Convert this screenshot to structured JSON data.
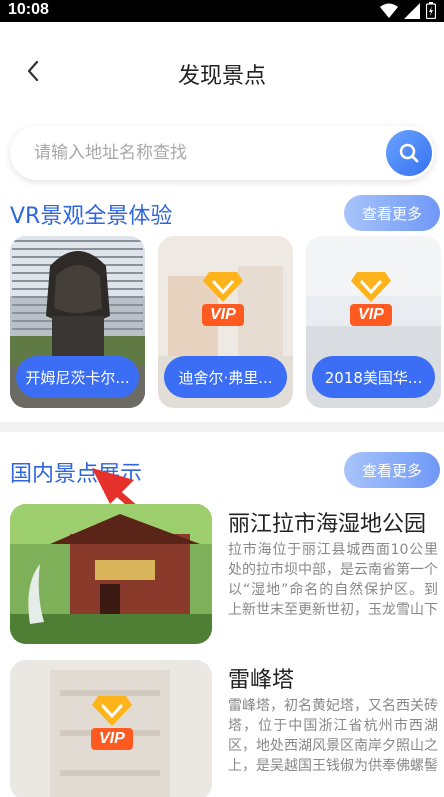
{
  "status": {
    "time": "10:08"
  },
  "header": {
    "title": "发现景点"
  },
  "search": {
    "placeholder": "请输入地址名称查找"
  },
  "vr_section": {
    "title": "VR景观全景体验",
    "more": "查看更多",
    "cards": [
      {
        "label": "开姆尼茨卡尔...",
        "vip": false
      },
      {
        "label": "迪舍尔·弗里...",
        "vip": true,
        "vip_text": "VIP"
      },
      {
        "label": "2018美国华...",
        "vip": true,
        "vip_text": "VIP"
      }
    ]
  },
  "domestic_section": {
    "title": "国内景点展示",
    "more": "查看更多",
    "items": [
      {
        "title": "丽江拉市海湿地公园",
        "desc": "拉市海位于丽江县城西面10公里处的拉市坝中部，是云南省第一个以“湿地”命名的自然保护区。到上新世末至更新世初，玉龙雪山下这个准平原又分割成...",
        "vip": false
      },
      {
        "title": "雷峰塔",
        "desc": "雷峰塔，初名黄妃塔，又名西关砖塔，位于中国浙江省杭州市西湖区，地处西湖风景区南岸夕照山之上，是吴越国王钱俶为供奉佛螺髻发舍利、祈求国泰民安...",
        "vip": true,
        "vip_text": "VIP"
      }
    ]
  },
  "colors": {
    "accent": "#2f66e0",
    "button": "#3b6ef5"
  }
}
